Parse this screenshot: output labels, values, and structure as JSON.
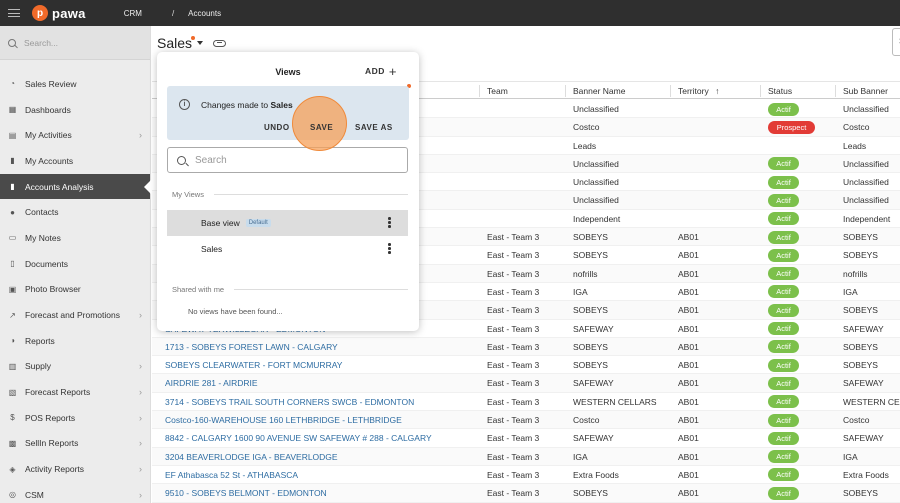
{
  "topbar": {
    "logo_letter": "p",
    "logo_text": "pawa",
    "crumb_1": "CRM",
    "crumb_sep": "/",
    "crumb_2": "Accounts"
  },
  "sidebar": {
    "search_placeholder": "Search...",
    "items": [
      {
        "label": "Sales Review",
        "icon": "gauge-icon",
        "glyph": "◔",
        "chevron": false
      },
      {
        "label": "Dashboards",
        "icon": "dashboard-icon",
        "glyph": "▦",
        "chevron": false
      },
      {
        "label": "My Activities",
        "icon": "calendar-icon",
        "glyph": "▤",
        "chevron": true
      },
      {
        "label": "My Accounts",
        "icon": "building-icon",
        "glyph": "▮",
        "chevron": false
      },
      {
        "label": "Accounts Analysis",
        "icon": "analysis-icon",
        "glyph": "▮",
        "chevron": false,
        "active": true
      },
      {
        "label": "Contacts",
        "icon": "contact-icon",
        "glyph": "●",
        "chevron": false
      },
      {
        "label": "My Notes",
        "icon": "note-icon",
        "glyph": "▭",
        "chevron": false
      },
      {
        "label": "Documents",
        "icon": "document-icon",
        "glyph": "▯",
        "chevron": false
      },
      {
        "label": "Photo Browser",
        "icon": "photo-icon",
        "glyph": "▣",
        "chevron": false
      },
      {
        "label": "Forecast and Promotions",
        "icon": "chart-icon",
        "glyph": "↗",
        "chevron": true
      },
      {
        "label": "Reports",
        "icon": "report-icon",
        "glyph": "◑",
        "chevron": false
      },
      {
        "label": "Supply",
        "icon": "supply-icon",
        "glyph": "▥",
        "chevron": true
      },
      {
        "label": "Forecast Reports",
        "icon": "forecast-icon",
        "glyph": "▧",
        "chevron": true
      },
      {
        "label": "POS Reports",
        "icon": "pos-icon",
        "glyph": "$",
        "chevron": true
      },
      {
        "label": "SellIn Reports",
        "icon": "sellin-icon",
        "glyph": "▩",
        "chevron": true
      },
      {
        "label": "Activity Reports",
        "icon": "activity-icon",
        "glyph": "◈",
        "chevron": true
      },
      {
        "label": "CSM",
        "icon": "csm-icon",
        "glyph": "◎",
        "chevron": true
      }
    ]
  },
  "main": {
    "view_title": "Sales",
    "right_search_glyph": "Se"
  },
  "table": {
    "headers": {
      "team": "Team",
      "banner": "Banner Name",
      "territory": "Territory",
      "territory_sort": "↑",
      "status": "Status",
      "sub_banner": "Sub Banner"
    },
    "rows": [
      {
        "account": "",
        "team": "",
        "banner": "Unclassified",
        "territory": "",
        "status": "Actif",
        "sub": "Unclassified"
      },
      {
        "account": "",
        "team": "",
        "banner": "Costco",
        "territory": "",
        "status": "Prospect",
        "sub": "Costco"
      },
      {
        "account": "",
        "team": "",
        "banner": "Leads",
        "territory": "",
        "status": "",
        "sub": "Leads"
      },
      {
        "account": "",
        "team": "",
        "banner": "Unclassified",
        "territory": "",
        "status": "Actif",
        "sub": "Unclassified"
      },
      {
        "account": "",
        "team": "",
        "banner": "Unclassified",
        "territory": "",
        "status": "Actif",
        "sub": "Unclassified"
      },
      {
        "account": "",
        "team": "",
        "banner": "Unclassified",
        "territory": "",
        "status": "Actif",
        "sub": "Unclassified"
      },
      {
        "account": "",
        "team": "",
        "banner": "Independent",
        "territory": "",
        "status": "Actif",
        "sub": "Independent"
      },
      {
        "account": "",
        "team": "East - Team 3",
        "banner": "SOBEYS",
        "territory": "AB01",
        "status": "Actif",
        "sub": "SOBEYS"
      },
      {
        "account": "",
        "team": "East - Team 3",
        "banner": "SOBEYS",
        "territory": "AB01",
        "status": "Actif",
        "sub": "SOBEYS"
      },
      {
        "account": "",
        "team": "East - Team 3",
        "banner": "nofrills",
        "territory": "AB01",
        "status": "Actif",
        "sub": "nofrills"
      },
      {
        "account": "",
        "team": "East - Team 3",
        "banner": "IGA",
        "territory": "AB01",
        "status": "Actif",
        "sub": "IGA"
      },
      {
        "account": "",
        "team": "East - Team 3",
        "banner": "SOBEYS",
        "territory": "AB01",
        "status": "Actif",
        "sub": "SOBEYS"
      },
      {
        "account": "",
        "team": "East - Team 3",
        "banner": "SAFEWAY",
        "territory": "AB01",
        "status": "Actif",
        "sub": "SAFEWAY"
      },
      {
        "account": "1713 - SOBEYS FOREST LAWN - CALGARY",
        "team": "East - Team 3",
        "banner": "SOBEYS",
        "territory": "AB01",
        "status": "Actif",
        "sub": "SOBEYS"
      },
      {
        "account": "SOBEYS CLEARWATER - FORT MCMURRAY",
        "team": "East - Team 3",
        "banner": "SOBEYS",
        "territory": "AB01",
        "status": "Actif",
        "sub": "SOBEYS"
      },
      {
        "account": "AIRDRIE 281 - AIRDRIE",
        "team": "East - Team 3",
        "banner": "SAFEWAY",
        "territory": "AB01",
        "status": "Actif",
        "sub": "SAFEWAY"
      },
      {
        "account": "3714 - SOBEYS TRAIL SOUTH CORNERS SWCB - EDMONTON",
        "team": "East - Team 3",
        "banner": "WESTERN CELLARS",
        "territory": "AB01",
        "status": "Actif",
        "sub": "WESTERN CE"
      },
      {
        "account": "Costco-160-WAREHOUSE 160 LETHBRIDGE - LETHBRIDGE",
        "team": "East - Team 3",
        "banner": "Costco",
        "territory": "AB01",
        "status": "Actif",
        "sub": "Costco"
      },
      {
        "account": "8842 - CALGARY 1600 90 AVENUE SW SAFEWAY # 288 - CALGARY",
        "team": "East - Team 3",
        "banner": "SAFEWAY",
        "territory": "AB01",
        "status": "Actif",
        "sub": "SAFEWAY"
      },
      {
        "account": "3204 BEAVERLODGE IGA - BEAVERLODGE",
        "team": "East - Team 3",
        "banner": "IGA",
        "territory": "AB01",
        "status": "Actif",
        "sub": "IGA"
      },
      {
        "account": "EF Athabasca 52 St - ATHABASCA",
        "team": "East - Team 3",
        "banner": "Extra Foods",
        "territory": "AB01",
        "status": "Actif",
        "sub": "Extra Foods"
      },
      {
        "account": "9510 - SOBEYS BELMONT - EDMONTON",
        "team": "East - Team 3",
        "banner": "SOBEYS",
        "territory": "AB01",
        "status": "Actif",
        "sub": "SOBEYS"
      }
    ],
    "partial_row_text": "SAFEWAY TERWILLEGAR - EDMONTON"
  },
  "views_panel": {
    "title": "Views",
    "add_label": "ADD",
    "notice_prefix": "Changes made to ",
    "notice_view": "Sales",
    "undo_label": "UNDO",
    "save_label": "SAVE",
    "save_as_label": "SAVE AS",
    "search_placeholder": "Search",
    "my_views_label": "My Views",
    "shared_label": "Shared with me",
    "empty_text": "No views have been found...",
    "views": [
      {
        "name": "Base view",
        "badge": "Default",
        "selected": true
      },
      {
        "name": "Sales",
        "badge": "",
        "selected": false
      }
    ]
  },
  "colors": {
    "accent": "#f06a2a",
    "actif": "#7cc04b",
    "prospect": "#e23b36",
    "link": "#2d6ca2",
    "topbar": "#2f2f2f"
  }
}
